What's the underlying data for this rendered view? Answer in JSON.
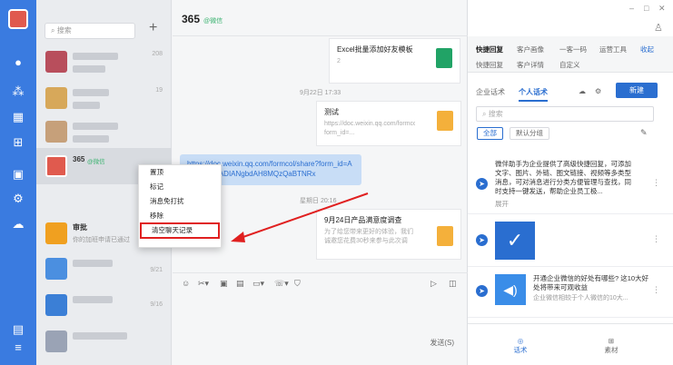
{
  "search": {
    "placeholder": "搜索"
  },
  "chats": [
    {
      "name": "",
      "sub": "",
      "time": "208"
    },
    {
      "name": "",
      "sub": "",
      "time": "19"
    },
    {
      "name": "",
      "sub": "",
      "time": ""
    },
    {
      "name": "365",
      "badge": "@微信",
      "time": ""
    },
    {
      "name": "审批",
      "sub": "你的加班申请已通过",
      "time": ""
    },
    {
      "name": "",
      "sub": "",
      "time": "9/21"
    },
    {
      "name": "",
      "sub": "",
      "time": "9/16"
    },
    {
      "name": "",
      "sub": "",
      "time": ""
    }
  ],
  "context_menu": [
    "置顶",
    "标记",
    "消息免打扰",
    "移除",
    "清空聊天记录"
  ],
  "chat": {
    "title": "365",
    "badge": "@微信",
    "card1_title": "Excel批量添加好友模板",
    "card1_sub": "2",
    "time1": "9月22日 17:33",
    "card2_title": "测试",
    "card2_sub": "https://doc.weixin.qq.com/formcol/share?form_id=...",
    "link": "https://doc.weixin.qq.com/formcol/share?form_id=AKQevAAYADIANgbdAH8MQzQaBTNRx",
    "time2": "星期日 20:16",
    "card3_title": "9月24日产品满意度调查",
    "card3_sub": "为了给您带来更好的体验，我们诚邀您花费30秒来参与此次调查...",
    "send": "发送(S)"
  },
  "right": {
    "tabs_row1": [
      "快捷回复",
      "客户画像",
      "一客一码",
      "运营工具",
      "收起"
    ],
    "tabs_row2": [
      "快捷回复",
      "客户详情",
      "自定义"
    ],
    "segments": [
      "企业话术",
      "个人话术"
    ],
    "new_button": "新建",
    "search_placeholder": "搜索",
    "chips": [
      "全部",
      "默认分组"
    ],
    "items": [
      "微伴助手为企业提供了高级快捷回复，可添加文字、图片、外链、图文链接、视频等多类型消息，可对消息进行分类方便管理与查找，同时支持一键发送，帮助企业员工极...",
      "",
      "开通企业微信的好处有哪些? 这10大好处将带来可观收益",
      "企业微信相较于个人微信的10大..."
    ],
    "expand": "展开",
    "footer": [
      "话术",
      "素材"
    ]
  },
  "colors": {
    "accent": "#2a6ed0",
    "rail": "#3a7be0",
    "highlight": "#e02020"
  }
}
